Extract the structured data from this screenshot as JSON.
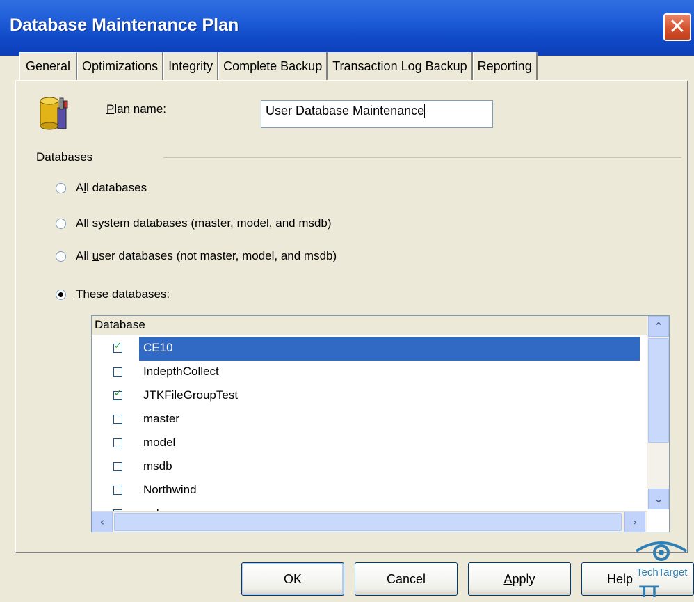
{
  "window": {
    "title": "Database Maintenance Plan",
    "close_glyph": "✕"
  },
  "tabs": [
    {
      "label": "General",
      "active": true
    },
    {
      "label": "Optimizations",
      "active": false
    },
    {
      "label": "Integrity",
      "active": false
    },
    {
      "label": "Complete Backup",
      "active": false
    },
    {
      "label": "Transaction Log Backup",
      "active": false
    },
    {
      "label": "Reporting",
      "active": false
    }
  ],
  "plan": {
    "label_mnemonic": "P",
    "label_rest": "lan name:",
    "value": "User Database Maintenance",
    "icon": "database-plan-icon"
  },
  "databases_group": {
    "label": "Databases",
    "options": [
      {
        "pre": "A",
        "mnemonic": "l",
        "post": "l databases",
        "selected": false
      },
      {
        "pre": "All ",
        "mnemonic": "s",
        "post": "ystem databases (master, model, and msdb)",
        "selected": false
      },
      {
        "pre": "All ",
        "mnemonic": "u",
        "post": "ser databases (not master, model, and msdb)",
        "selected": false
      },
      {
        "pre": "",
        "mnemonic": "T",
        "post": "hese databases:",
        "selected": true
      }
    ]
  },
  "db_grid": {
    "header": "Database",
    "rows": [
      {
        "name": "CE10",
        "checked": true,
        "selected": true
      },
      {
        "name": "IndepthCollect",
        "checked": false,
        "selected": false
      },
      {
        "name": "JTKFileGroupTest",
        "checked": true,
        "selected": false
      },
      {
        "name": "master",
        "checked": false,
        "selected": false
      },
      {
        "name": "model",
        "checked": false,
        "selected": false
      },
      {
        "name": "msdb",
        "checked": false,
        "selected": false
      },
      {
        "name": "Northwind",
        "checked": false,
        "selected": false
      },
      {
        "name": "pubs",
        "checked": false,
        "selected": false
      }
    ]
  },
  "buttons": {
    "ok": "OK",
    "cancel": "Cancel",
    "apply_mnemonic": "A",
    "apply_rest": "pply",
    "help": "Help"
  },
  "watermark": {
    "text": "TechTarget",
    "logo": "TT"
  },
  "colors": {
    "titlebar": "#1f5ed8",
    "selection": "#316ac5",
    "close_button": "#d24f2a"
  }
}
